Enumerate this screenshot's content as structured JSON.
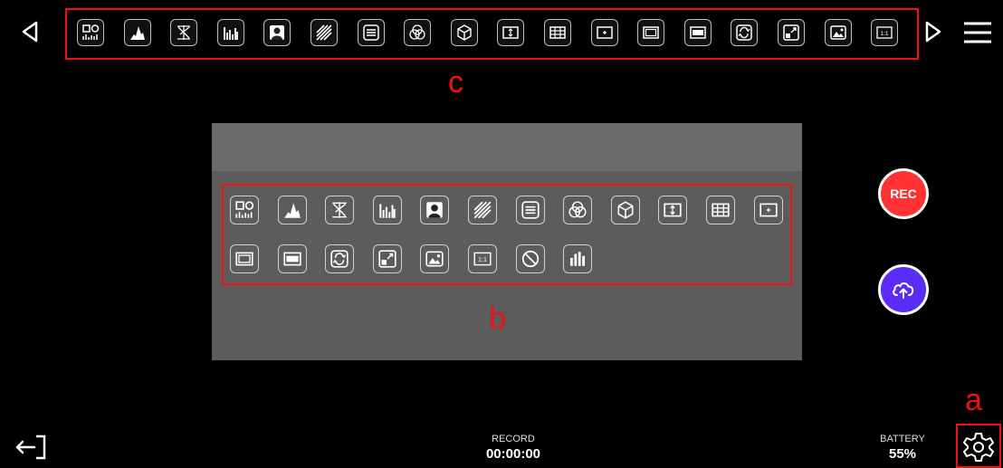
{
  "toolbar": {
    "tools": [
      {
        "icon": "monitor-combo-icon"
      },
      {
        "icon": "histogram-icon"
      },
      {
        "icon": "waveform-icon"
      },
      {
        "icon": "bar-meter-icon"
      },
      {
        "icon": "person-icon"
      },
      {
        "icon": "zebra-icon"
      },
      {
        "icon": "lines-icon"
      },
      {
        "icon": "color-circles-icon"
      },
      {
        "icon": "cube-icon"
      },
      {
        "icon": "frame-line-icon"
      },
      {
        "icon": "grid-icon"
      },
      {
        "icon": "center-mark-icon"
      },
      {
        "icon": "safe-area-icon"
      },
      {
        "icon": "anamorphic-icon"
      },
      {
        "icon": "flip-icon"
      },
      {
        "icon": "zoom-area-icon"
      },
      {
        "icon": "image-icon"
      },
      {
        "icon": "ratio-icon"
      }
    ],
    "ratio_label": "1:1"
  },
  "panel": {
    "tools": [
      {
        "icon": "monitor-combo-icon"
      },
      {
        "icon": "histogram-icon"
      },
      {
        "icon": "waveform-icon"
      },
      {
        "icon": "bar-meter-icon"
      },
      {
        "icon": "person-icon"
      },
      {
        "icon": "zebra-icon"
      },
      {
        "icon": "lines-icon"
      },
      {
        "icon": "color-circles-icon"
      },
      {
        "icon": "cube-icon"
      },
      {
        "icon": "frame-line-icon"
      },
      {
        "icon": "grid-icon"
      },
      {
        "icon": "center-mark-icon"
      },
      {
        "icon": "safe-area-icon"
      },
      {
        "icon": "anamorphic-icon"
      },
      {
        "icon": "flip-icon"
      },
      {
        "icon": "zoom-area-icon"
      },
      {
        "icon": "image-icon"
      },
      {
        "icon": "ratio-icon"
      },
      {
        "icon": "none-icon"
      },
      {
        "icon": "level-bars-icon"
      }
    ],
    "ratio_label": "1:1"
  },
  "buttons": {
    "rec_label": "REC"
  },
  "status": {
    "record_label": "RECORD",
    "record_time": "00:00:00",
    "battery_label": "BATTERY",
    "battery_value": "55%"
  },
  "annotations": {
    "a": "a",
    "b": "b",
    "c": "c"
  },
  "colors": {
    "annotation": "#ee1111",
    "rec": "#ff3333",
    "upload": "#5b2cf5",
    "panel": "#5c5c5c"
  }
}
